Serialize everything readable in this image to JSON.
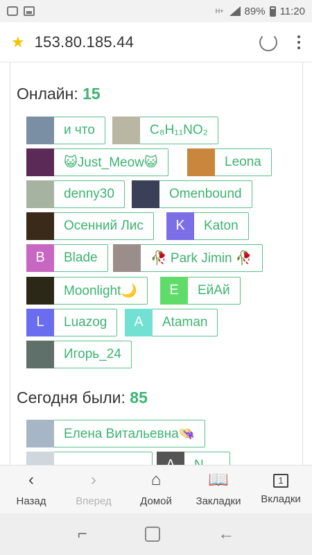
{
  "status": {
    "hplus": "H+",
    "battery": "89%",
    "time": "11:20"
  },
  "address": {
    "url": "153.80.185.44"
  },
  "online": {
    "label": "Онлайн:",
    "count": "15",
    "users": [
      {
        "name": "и что",
        "avatar_text": "",
        "avatar_color": "#7a8fa3"
      },
      {
        "name": "C₈H₁₁NO₂",
        "avatar_text": "",
        "avatar_color": "#b9b6a1"
      },
      {
        "name": "😺Just_Meow😺",
        "avatar_text": "",
        "avatar_color": "#5c2a57"
      },
      {
        "name": "Leona",
        "avatar_text": "",
        "avatar_color": "#c9863c"
      },
      {
        "name": "denny30",
        "avatar_text": "",
        "avatar_color": "#a6b3a0"
      },
      {
        "name": "Omenbound",
        "avatar_text": "",
        "avatar_color": "#3c3f58"
      },
      {
        "name": "Осенний Лис",
        "avatar_text": "",
        "avatar_color": "#3a2a1a"
      },
      {
        "name": "Katon",
        "avatar_text": "K",
        "avatar_color": "#7b6ee6"
      },
      {
        "name": "Blade",
        "avatar_text": "B",
        "avatar_color": "#c867c1"
      },
      {
        "name": "🥀 Park Jimin 🥀",
        "avatar_text": "",
        "avatar_color": "#9b8d8a"
      },
      {
        "name": "Moonlight🌙",
        "avatar_text": "",
        "avatar_color": "#2c2818"
      },
      {
        "name": "ЕйАй",
        "avatar_text": "E",
        "avatar_color": "#5fdc69"
      },
      {
        "name": "Luazog",
        "avatar_text": "L",
        "avatar_color": "#6a6df0"
      },
      {
        "name": "Ataman",
        "avatar_text": "A",
        "avatar_color": "#72e0d2"
      },
      {
        "name": "Игорь_24",
        "avatar_text": "",
        "avatar_color": "#5f6f6a"
      }
    ]
  },
  "today": {
    "label": "Сегодня были:",
    "count": "85",
    "users": [
      {
        "name": "Елена Витальевна👒",
        "avatar_text": "",
        "avatar_color": "#a7b6c4"
      },
      {
        "name": "",
        "avatar_text": "",
        "avatar_color": "#cfd6dc"
      },
      {
        "name": "N",
        "avatar_text": "A",
        "avatar_color": "#555555"
      }
    ]
  },
  "toolbar": {
    "back": "Назад",
    "forward": "Вперед",
    "home": "Домой",
    "bookmarks": "Закладки",
    "tabs": "Вкладки",
    "tabs_count": "1"
  }
}
